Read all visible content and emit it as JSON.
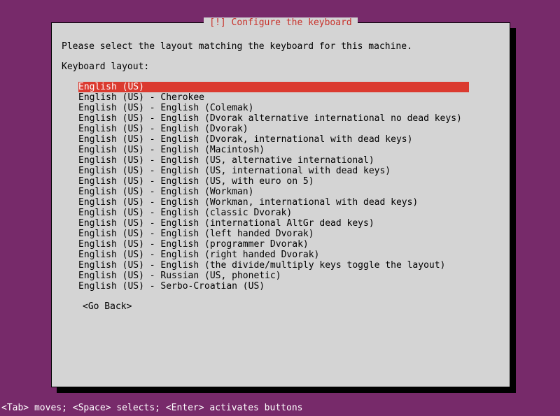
{
  "dialog": {
    "title": "[!] Configure the keyboard",
    "instruction": "Please select the layout matching the keyboard for this machine.",
    "label": "Keyboard layout:",
    "selectedIndex": 0,
    "items": [
      "English (US)",
      "English (US) - Cherokee",
      "English (US) - English (Colemak)",
      "English (US) - English (Dvorak alternative international no dead keys)",
      "English (US) - English (Dvorak)",
      "English (US) - English (Dvorak, international with dead keys)",
      "English (US) - English (Macintosh)",
      "English (US) - English (US, alternative international)",
      "English (US) - English (US, international with dead keys)",
      "English (US) - English (US, with euro on 5)",
      "English (US) - English (Workman)",
      "English (US) - English (Workman, international with dead keys)",
      "English (US) - English (classic Dvorak)",
      "English (US) - English (international AltGr dead keys)",
      "English (US) - English (left handed Dvorak)",
      "English (US) - English (programmer Dvorak)",
      "English (US) - English (right handed Dvorak)",
      "English (US) - English (the divide/multiply keys toggle the layout)",
      "English (US) - Russian (US, phonetic)",
      "English (US) - Serbo-Croatian (US)"
    ],
    "goBack": "<Go Back>"
  },
  "statusBar": "<Tab> moves; <Space> selects; <Enter> activates buttons"
}
